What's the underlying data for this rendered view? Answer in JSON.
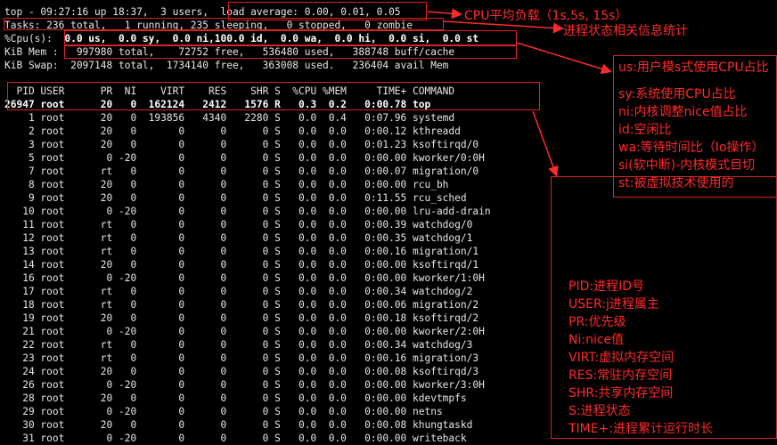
{
  "summary": {
    "line1_pre": "top - 09:27:16 up 18:37,  3 users,  ",
    "line1_load": "load average: 0.00, 0.01, 0.05",
    "line2": "Tasks: 236 total,   1 running, 235 sleeping,   0 stopped,   0 zombie",
    "line3_pre": "%Cpu(s): ",
    "line3_vals": " 0.0 us,  0.0 sy,  0.0 ni,100.0 id,  0.0 wa,  0.0 hi,  0.0 si,  0.0 st",
    "line4": "KiB Mem :   997980 total,    72752 free,   536480 used,   388748 buff/cache",
    "line5": "KiB Swap:  2097148 total,  1734140 free,   363008 used.   236404 avail Mem"
  },
  "table": {
    "header": "  PID USER      PR  NI    VIRT    RES    SHR S  %CPU %MEM     TIME+ COMMAND",
    "rows": [
      "26947 root      20   0  162124   2412   1576 R   0.3  0.2   0:00.78 top",
      "    1 root      20   0  193856   4340   2280 S   0.0  0.4   0:07.96 systemd",
      "    2 root      20   0       0      0      0 S   0.0  0.0   0:00.12 kthreadd",
      "    3 root      20   0       0      0      0 S   0.0  0.0   0:01.23 ksoftirqd/0",
      "    5 root       0 -20       0      0      0 S   0.0  0.0   0:00.00 kworker/0:0H",
      "    7 root      rt   0       0      0      0 S   0.0  0.0   0:00.07 migration/0",
      "    8 root      20   0       0      0      0 S   0.0  0.0   0:00.00 rcu_bh",
      "    9 root      20   0       0      0      0 S   0.0  0.0   0:11.55 rcu_sched",
      "   10 root       0 -20       0      0      0 S   0.0  0.0   0:00.00 lru-add-drain",
      "   11 root      rt   0       0      0      0 S   0.0  0.0   0:00.39 watchdog/0",
      "   12 root      rt   0       0      0      0 S   0.0  0.0   0:00.35 watchdog/1",
      "   13 root      rt   0       0      0      0 S   0.0  0.0   0:00.16 migration/1",
      "   14 root      20   0       0      0      0 S   0.0  0.0   0:00.00 ksoftirqd/1",
      "   16 root       0 -20       0      0      0 S   0.0  0.0   0:00.00 kworker/1:0H",
      "   17 root      rt   0       0      0      0 S   0.0  0.0   0:00.34 watchdog/2",
      "   18 root      rt   0       0      0      0 S   0.0  0.0   0:00.06 migration/2",
      "   19 root      20   0       0      0      0 S   0.0  0.0   0:00.18 ksoftirqd/2",
      "   21 root       0 -20       0      0      0 S   0.0  0.0   0:00.00 kworker/2:0H",
      "   22 root      rt   0       0      0      0 S   0.0  0.0   0:00.34 watchdog/3",
      "   23 root      rt   0       0      0      0 S   0.0  0.0   0:00.16 migration/3",
      "   24 root      20   0       0      0      0 S   0.0  0.0   0:00.08 ksoftirqd/3",
      "   26 root       0 -20       0      0      0 S   0.0  0.0   0:00.00 kworker/3:0H",
      "   28 root      20   0       0      0      0 S   0.0  0.0   0:00.00 kdevtmpfs",
      "   29 root       0 -20       0      0      0 S   0.0  0.0   0:00.00 netns",
      "   30 root      20   0       0      0      0 S   0.0  0.0   0:00.08 khungtaskd",
      "   31 root       0 -20       0      0      0 S   0.0  0.0   0:00.00 writeback"
    ]
  },
  "annotations": {
    "load_note": "CPU平均负载（1s,5s, 15s）",
    "state_note": "进程状态相关信息统计",
    "cpu_panel": [
      "us:用户模s式使用CPU占比",
      "",
      "sy:系统使用CPU占比",
      "ni:内核调整nice值占比",
      "id:空闲比",
      "wa:等待时间比（Io操作）",
      "si(软中断)-内核模式目切",
      "st:被虚拟技术使用的"
    ],
    "column_panel": [
      "PID:进程ID号",
      "USER:j进程属主",
      "PR:优先级",
      "Ni:nice值",
      "VIRT:虚拟内存空间",
      "RES:常驻内存空间",
      "SHR:共享内存空间",
      "S:进程状态",
      "TIME+:进程累计运行时长"
    ]
  },
  "colors": {
    "annotation": "#ff2a2a",
    "box": "#d22"
  }
}
